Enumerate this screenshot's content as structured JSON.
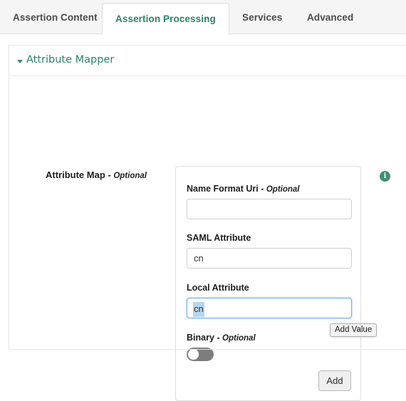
{
  "tabs": [
    {
      "label": "Assertion Content",
      "active": false
    },
    {
      "label": "Assertion Processing",
      "active": true
    },
    {
      "label": "Services",
      "active": false
    },
    {
      "label": "Advanced",
      "active": false
    }
  ],
  "section": {
    "title": "Attribute Mapper",
    "caret_icon": "caret-down-icon",
    "expanded": true
  },
  "attribute_map": {
    "label_main": "Attribute Map - ",
    "label_optional": "Optional",
    "info_icon": "info-icon",
    "info_glyph": "i"
  },
  "fields": {
    "name_format_uri": {
      "label_main": "Name Format Uri - ",
      "label_optional": "Optional",
      "value": "",
      "placeholder": ""
    },
    "saml_attribute": {
      "label": "SAML Attribute",
      "value": "cn",
      "placeholder": ""
    },
    "local_attribute": {
      "label": "Local Attribute",
      "value": "cn",
      "placeholder": "",
      "focused": true,
      "selected_text": "cn"
    },
    "binary": {
      "label_main": "Binary - ",
      "label_optional": "Optional",
      "toggle_state": "off"
    }
  },
  "add_button": {
    "label": "Add"
  },
  "tooltip": {
    "text": "Add Value"
  },
  "colors": {
    "accent_green": "#2d8368",
    "tab_bar_bg": "#f5f5f5",
    "focus_blue": "#66afe9",
    "selection_blue": "#b5d6f0",
    "toggle_off": "#7d7d7d",
    "button_bg": "#efefef"
  }
}
